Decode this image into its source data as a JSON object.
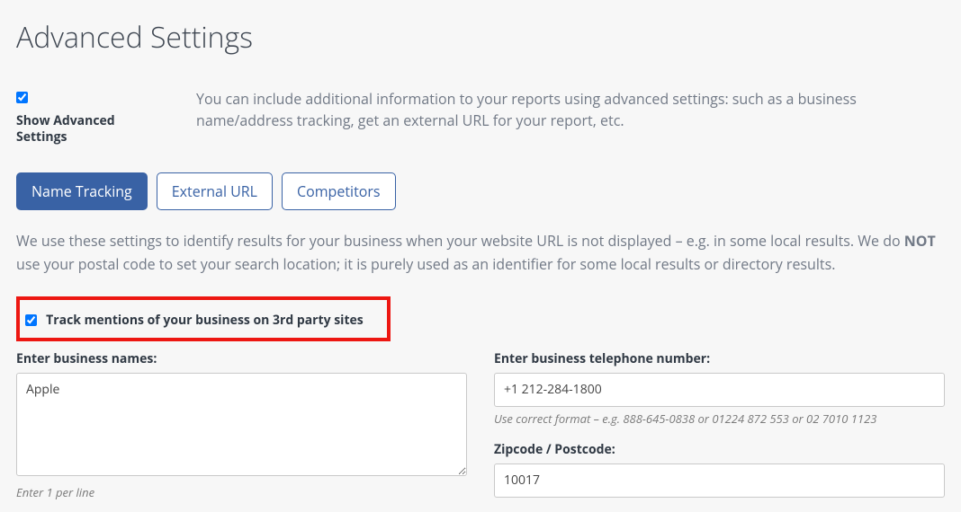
{
  "title": "Advanced Settings",
  "showAdvanced": {
    "label": "Show Advanced Settings"
  },
  "description": "You can include additional information to your reports using advanced settings: such as a business name/address tracking, get an external URL for your report, etc.",
  "tabs": {
    "nameTracking": "Name Tracking",
    "externalUrl": "External URL",
    "competitors": "Competitors"
  },
  "infoParagraphPre": "We use these settings to identify results for your business when your website URL is not displayed – e.g. in some local results. We do ",
  "infoParagraphBold": "NOT",
  "infoParagraphPost": " use your postal code to set your search location; it is purely used as an identifier for some local results or directory results.",
  "trackMentionsLabel": "Track mentions of your business on 3rd party sites",
  "form": {
    "businessNames": {
      "label": "Enter business names:",
      "value": "Apple",
      "hint": "Enter 1 per line"
    },
    "telephone": {
      "label": "Enter business telephone number:",
      "value": "+1 212-284-1800",
      "hint": "Use correct format – e.g. 888-645-0838 or 01224 872 553 or 02 7010 1123"
    },
    "zipcode": {
      "label": "Zipcode / Postcode:",
      "value": "10017"
    }
  }
}
